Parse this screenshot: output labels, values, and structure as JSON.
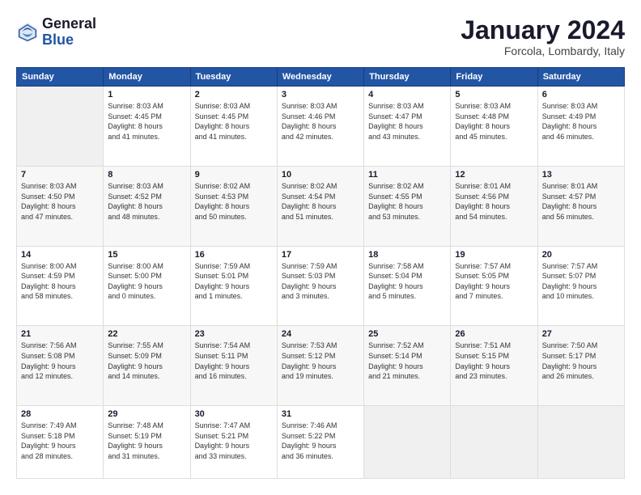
{
  "header": {
    "logo_general": "General",
    "logo_blue": "Blue",
    "month_title": "January 2024",
    "location": "Forcola, Lombardy, Italy"
  },
  "days_of_week": [
    "Sunday",
    "Monday",
    "Tuesday",
    "Wednesday",
    "Thursday",
    "Friday",
    "Saturday"
  ],
  "weeks": [
    [
      {
        "num": "",
        "sunrise": "",
        "sunset": "",
        "daylight": ""
      },
      {
        "num": "1",
        "sunrise": "8:03 AM",
        "sunset": "4:45 PM",
        "hours": "8",
        "minutes": "41"
      },
      {
        "num": "2",
        "sunrise": "8:03 AM",
        "sunset": "4:45 PM",
        "hours": "8",
        "minutes": "41"
      },
      {
        "num": "3",
        "sunrise": "8:03 AM",
        "sunset": "4:46 PM",
        "hours": "8",
        "minutes": "42"
      },
      {
        "num": "4",
        "sunrise": "8:03 AM",
        "sunset": "4:47 PM",
        "hours": "8",
        "minutes": "43"
      },
      {
        "num": "5",
        "sunrise": "8:03 AM",
        "sunset": "4:48 PM",
        "hours": "8",
        "minutes": "45"
      },
      {
        "num": "6",
        "sunrise": "8:03 AM",
        "sunset": "4:49 PM",
        "hours": "8",
        "minutes": "46"
      }
    ],
    [
      {
        "num": "7",
        "sunrise": "8:03 AM",
        "sunset": "4:50 PM",
        "hours": "8",
        "minutes": "47"
      },
      {
        "num": "8",
        "sunrise": "8:03 AM",
        "sunset": "4:52 PM",
        "hours": "8",
        "minutes": "48"
      },
      {
        "num": "9",
        "sunrise": "8:02 AM",
        "sunset": "4:53 PM",
        "hours": "8",
        "minutes": "50"
      },
      {
        "num": "10",
        "sunrise": "8:02 AM",
        "sunset": "4:54 PM",
        "hours": "8",
        "minutes": "51"
      },
      {
        "num": "11",
        "sunrise": "8:02 AM",
        "sunset": "4:55 PM",
        "hours": "8",
        "minutes": "53"
      },
      {
        "num": "12",
        "sunrise": "8:01 AM",
        "sunset": "4:56 PM",
        "hours": "8",
        "minutes": "54"
      },
      {
        "num": "13",
        "sunrise": "8:01 AM",
        "sunset": "4:57 PM",
        "hours": "8",
        "minutes": "56"
      }
    ],
    [
      {
        "num": "14",
        "sunrise": "8:00 AM",
        "sunset": "4:59 PM",
        "hours": "8",
        "minutes": "58"
      },
      {
        "num": "15",
        "sunrise": "8:00 AM",
        "sunset": "5:00 PM",
        "hours": "9",
        "minutes": "0"
      },
      {
        "num": "16",
        "sunrise": "7:59 AM",
        "sunset": "5:01 PM",
        "hours": "9",
        "minutes": "1"
      },
      {
        "num": "17",
        "sunrise": "7:59 AM",
        "sunset": "5:03 PM",
        "hours": "9",
        "minutes": "3"
      },
      {
        "num": "18",
        "sunrise": "7:58 AM",
        "sunset": "5:04 PM",
        "hours": "9",
        "minutes": "5"
      },
      {
        "num": "19",
        "sunrise": "7:57 AM",
        "sunset": "5:05 PM",
        "hours": "9",
        "minutes": "7"
      },
      {
        "num": "20",
        "sunrise": "7:57 AM",
        "sunset": "5:07 PM",
        "hours": "9",
        "minutes": "10"
      }
    ],
    [
      {
        "num": "21",
        "sunrise": "7:56 AM",
        "sunset": "5:08 PM",
        "hours": "9",
        "minutes": "12"
      },
      {
        "num": "22",
        "sunrise": "7:55 AM",
        "sunset": "5:09 PM",
        "hours": "9",
        "minutes": "14"
      },
      {
        "num": "23",
        "sunrise": "7:54 AM",
        "sunset": "5:11 PM",
        "hours": "9",
        "minutes": "16"
      },
      {
        "num": "24",
        "sunrise": "7:53 AM",
        "sunset": "5:12 PM",
        "hours": "9",
        "minutes": "19"
      },
      {
        "num": "25",
        "sunrise": "7:52 AM",
        "sunset": "5:14 PM",
        "hours": "9",
        "minutes": "21"
      },
      {
        "num": "26",
        "sunrise": "7:51 AM",
        "sunset": "5:15 PM",
        "hours": "9",
        "minutes": "23"
      },
      {
        "num": "27",
        "sunrise": "7:50 AM",
        "sunset": "5:17 PM",
        "hours": "9",
        "minutes": "26"
      }
    ],
    [
      {
        "num": "28",
        "sunrise": "7:49 AM",
        "sunset": "5:18 PM",
        "hours": "9",
        "minutes": "28"
      },
      {
        "num": "29",
        "sunrise": "7:48 AM",
        "sunset": "5:19 PM",
        "hours": "9",
        "minutes": "31"
      },
      {
        "num": "30",
        "sunrise": "7:47 AM",
        "sunset": "5:21 PM",
        "hours": "9",
        "minutes": "33"
      },
      {
        "num": "31",
        "sunrise": "7:46 AM",
        "sunset": "5:22 PM",
        "hours": "9",
        "minutes": "36"
      },
      {
        "num": "",
        "sunrise": "",
        "sunset": "",
        "hours": "",
        "minutes": ""
      },
      {
        "num": "",
        "sunrise": "",
        "sunset": "",
        "hours": "",
        "minutes": ""
      },
      {
        "num": "",
        "sunrise": "",
        "sunset": "",
        "hours": "",
        "minutes": ""
      }
    ]
  ]
}
